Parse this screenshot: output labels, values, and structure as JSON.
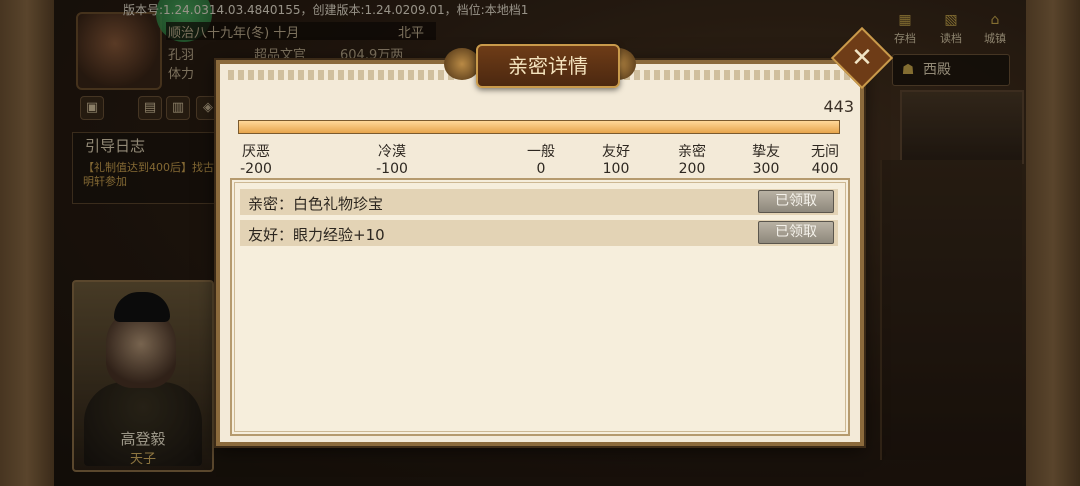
{
  "version_text": "版本号:1.24.0314.03.4840155，创建版本:1.24.0209.01，档位:本地档1",
  "hud": {
    "date": "顺治八十九年(冬) 十月",
    "region": "北平",
    "name": "孔羽",
    "rank": "超品文官",
    "money": "604.9万两",
    "stamina_label": "体力"
  },
  "guide": {
    "title": "引导日志",
    "text": "【礼制值达到400后】找古明轩参加"
  },
  "card": {
    "name": "高登毅",
    "title": "天子"
  },
  "right_icons": [
    "存档",
    "读档",
    "城镇"
  ],
  "west_button": "西殿",
  "dialog": {
    "title": "亲密详情",
    "score": "443",
    "progress": {
      "value": 443,
      "min": -200,
      "max": 400
    },
    "ticks": [
      {
        "label": "厌恶",
        "value": "-200"
      },
      {
        "label": "冷漠",
        "value": "-100"
      },
      {
        "label": "一般",
        "value": "0"
      },
      {
        "label": "友好",
        "value": "100"
      },
      {
        "label": "亲密",
        "value": "200"
      },
      {
        "label": "挚友",
        "value": "300"
      },
      {
        "label": "无间",
        "value": "400"
      }
    ],
    "rewards": [
      {
        "label": "亲密：白色礼物珍宝",
        "button": "已领取"
      },
      {
        "label": "友好：眼力经验+10",
        "button": "已领取"
      }
    ]
  }
}
